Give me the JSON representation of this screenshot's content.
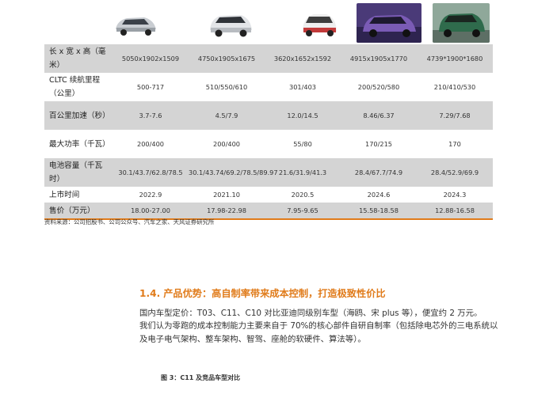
{
  "table": {
    "rows": [
      {
        "label": "长 x 宽 x 高（毫米）",
        "values": [
          "5050x1902x1509",
          "4750x1905x1675",
          "3620x1652x1592",
          "4915x1905x1770",
          "4739*1900*1680"
        ]
      },
      {
        "label": "CLTC 续航里程（公里）",
        "values": [
          "500-717",
          "510/550/610",
          "301/403",
          "200/520/580",
          "210/410/530"
        ]
      },
      {
        "label": "百公里加速（秒）",
        "values": [
          "3.7-7.6",
          "4.5/7.9",
          "12.0/14.5",
          "8.46/6.37",
          "7.29/7.68"
        ]
      },
      {
        "label": "最大功率（千瓦）",
        "values": [
          "200/400",
          "200/400",
          "55/80",
          "170/215",
          "170"
        ]
      },
      {
        "label": "电池容量（千瓦时）",
        "values": [
          "30.1/43.7/62.8/78.5",
          "30.1/43.74/69.2/78.5/89.97",
          "21.6/31.9/41.3",
          "28.4/67.7/74.9",
          "28.4/52.9/69.9"
        ]
      },
      {
        "label": "上市时间",
        "values": [
          "2022.9",
          "2021.10",
          "2020.5",
          "2024.6",
          "2024.3"
        ]
      },
      {
        "label": "售价（万元）",
        "values": [
          "18.00-27.00",
          "17.98-22.98",
          "7.95-9.65",
          "15.58-18.58",
          "12.88-16.58"
        ]
      }
    ],
    "source": "资料来源：公司招股书、公司公众号、汽车之家、天风证券研究所"
  },
  "section": {
    "number": "1.4.",
    "title": "产品优势：高自制率带来成本控制，打造极致性价比",
    "para1": "国内车型定价：T03、C11、C10 对比亚迪同级别车型（海鸥、宋 plus 等），便宜约 2 万元。",
    "para2": "我们认为零跑的成本控制能力主要来自于 70%的核心部件自研自制率（包括除电芯外的三电系统以及电子电气架构、整车架构、智驾、座舱的软硬件、算法等）。"
  },
  "figure_caption": "图 3：C11 及竞品车型对比",
  "colors": {
    "accent": "#e07b1a",
    "row_shade": "#d4d4d4"
  }
}
